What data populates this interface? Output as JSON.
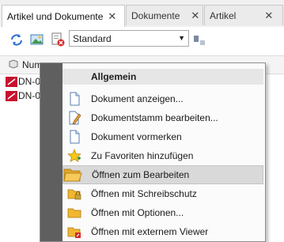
{
  "tabs": [
    {
      "label": "Artikel und Dokumente",
      "close": "✕"
    },
    {
      "label": "Dokumente",
      "close": "✕"
    },
    {
      "label": "Artikel",
      "close": "✕"
    }
  ],
  "toolbar": {
    "view_select": "Standard"
  },
  "grid": {
    "header_label": "Num",
    "rows": [
      {
        "label": "DN-0"
      },
      {
        "label": "DN-0"
      }
    ]
  },
  "context_menu": {
    "header": "Allgemein",
    "items": [
      {
        "label": "Dokument anzeigen...",
        "icon": "document-icon"
      },
      {
        "label": "Dokumentstamm bearbeiten...",
        "icon": "document-edit-icon"
      },
      {
        "label": "Dokument vormerken",
        "icon": "document-mark-icon"
      },
      {
        "label": "Zu Favoriten hinzufügen",
        "icon": "favorite-star-icon"
      },
      {
        "label": "Öffnen zum Bearbeiten",
        "icon": "open-folder-icon",
        "highlighted": true
      },
      {
        "label": "Öffnen mit Schreibschutz",
        "icon": "folder-lock-icon"
      },
      {
        "label": "Öffnen mit Optionen...",
        "icon": "folder-icon"
      },
      {
        "label": "Öffnen mit externem Viewer",
        "icon": "folder-external-icon"
      }
    ]
  },
  "colors": {
    "menu_gutter": "#5f5f5f",
    "highlight": "#d9d9d9",
    "folder": "#f2b630"
  }
}
